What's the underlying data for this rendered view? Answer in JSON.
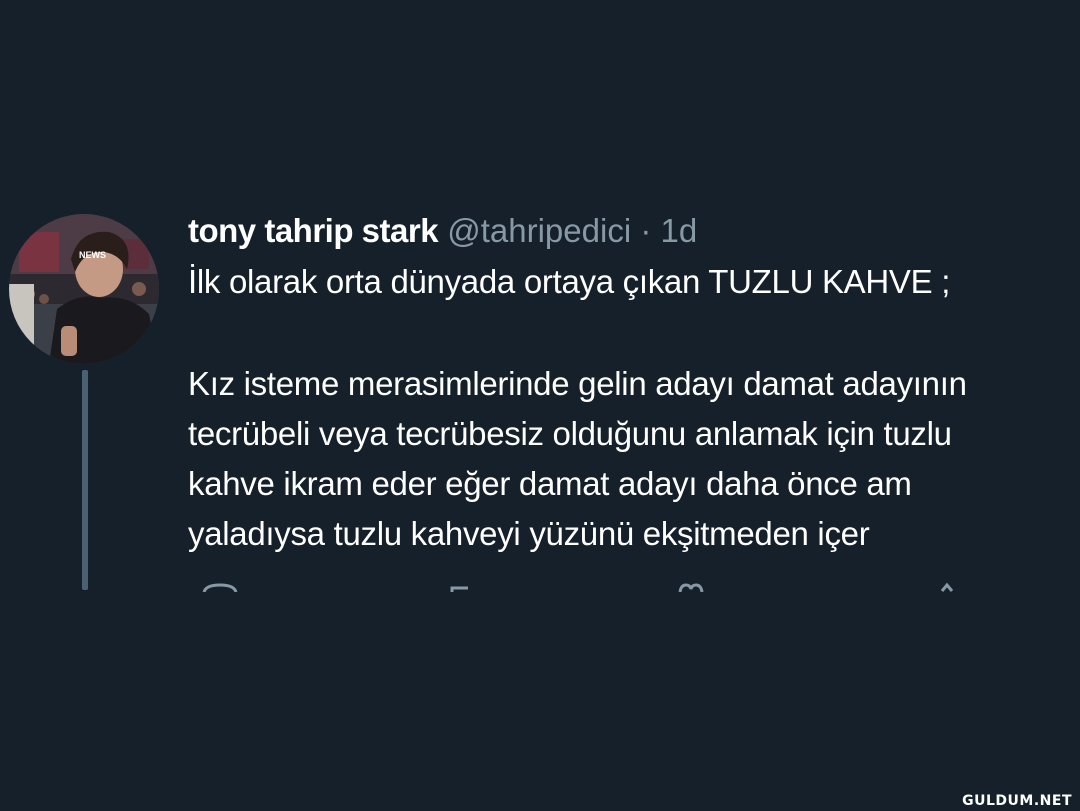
{
  "tweet": {
    "display_name": "tony tahrip stark",
    "handle": "@tahripedici",
    "separator": "·",
    "time": "1d",
    "avatar_badge": "NEWS",
    "lines": [
      "İlk olarak orta dünyada ortaya çıkan TUZLU KAHVE ;",
      "",
      "Kız isteme merasimlerinde gelin adayı damat adayının",
      "tecrübeli veya tecrübesiz olduğunu anlamak için tuzlu",
      "kahve ikram eder eğer damat adayı daha önce am",
      "yaladıysa tuzlu kahveyi yüzünü ekşitmeden içer"
    ],
    "actions": [
      "reply-icon",
      "retweet-icon",
      "like-icon",
      "share-icon"
    ]
  },
  "watermark": "GULDUM.NET",
  "colors": {
    "background": "#15202b",
    "text": "#ffffff",
    "secondary": "#8899a6",
    "thread_line": "#4a6170"
  }
}
